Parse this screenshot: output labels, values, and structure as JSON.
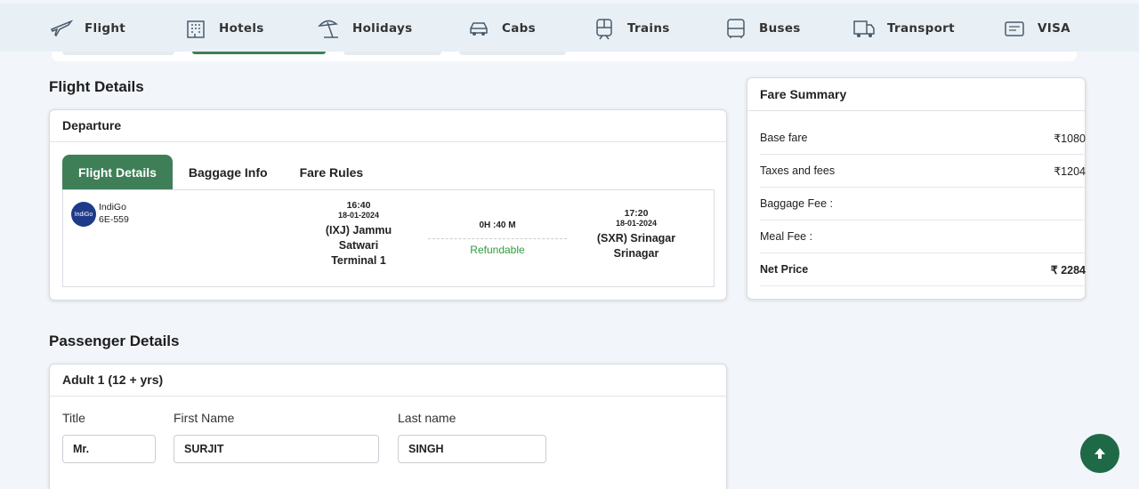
{
  "nav": {
    "items": [
      {
        "label": "Flight",
        "icon": "plane-icon"
      },
      {
        "label": "Hotels",
        "icon": "hotel-icon"
      },
      {
        "label": "Holidays",
        "icon": "beach-umbrella-icon"
      },
      {
        "label": "Cabs",
        "icon": "car-icon"
      },
      {
        "label": "Trains",
        "icon": "train-icon"
      },
      {
        "label": "Buses",
        "icon": "bus-icon"
      },
      {
        "label": "Transport",
        "icon": "truck-icon"
      },
      {
        "label": "VISA",
        "icon": "visa-card-icon"
      }
    ]
  },
  "flight_details": {
    "title": "Flight Details",
    "card_title": "Departure",
    "tabs": [
      "Flight Details",
      "Baggage Info",
      "Fare Rules"
    ],
    "active_tab": "Flight Details",
    "airline": {
      "name": "IndiGo",
      "code": "6E-559",
      "logo_text": "IndiGo"
    },
    "departure": {
      "time": "16:40",
      "date": "18-01-2024",
      "place_line1": "(IXJ) Jammu",
      "place_line2": "Satwari",
      "terminal": "Terminal 1"
    },
    "duration": "0H :40 M",
    "refund_status": "Refundable",
    "arrival": {
      "time": "17:20",
      "date": "18-01-2024",
      "place_line1": "(SXR) Srinagar",
      "place_line2": "Srinagar"
    }
  },
  "fare_summary": {
    "title": "Fare Summary",
    "rows": [
      {
        "label": "Base fare",
        "value": "₹1080"
      },
      {
        "label": "Taxes and fees",
        "value": "₹1204"
      },
      {
        "label": "Baggage Fee :",
        "value": ""
      },
      {
        "label": "Meal Fee :",
        "value": ""
      },
      {
        "label": "Net Price",
        "value": "₹ 2284"
      }
    ]
  },
  "passenger_details": {
    "title": "Passenger Details",
    "card_title": "Adult 1 (12 + yrs)",
    "fields": {
      "title_label": "Title",
      "title_value": "Mr.",
      "first_name_label": "First Name",
      "first_name_value": "SURJIT",
      "last_name_label": "Last name",
      "last_name_value": "SINGH"
    }
  },
  "colors": {
    "accent": "#3f7f57",
    "refund": "#2e9e3a",
    "scroll_button": "#1f6a46"
  }
}
